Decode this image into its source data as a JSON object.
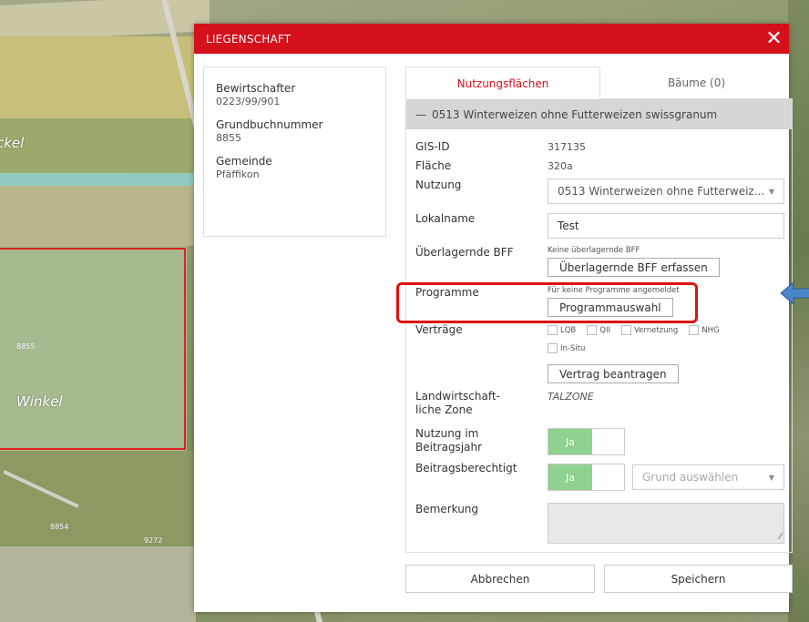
{
  "map": {
    "labels": [
      "ckel",
      "Winkel"
    ],
    "numbers": [
      "8855",
      "8854",
      "9272"
    ]
  },
  "dialog": {
    "title": "LIEGENSCHAFT",
    "close_glyph": "✕",
    "info": {
      "bewirtschafter_label": "Bewirtschafter",
      "bewirtschafter_value": "0223/99/901",
      "grundbuch_label": "Grundbuchnummer",
      "grundbuch_value": "8855",
      "gemeinde_label": "Gemeinde",
      "gemeinde_value": "Pfäffikon"
    },
    "tabs": [
      {
        "label": "Nutzungsflächen",
        "active": true
      },
      {
        "label": "Bäume (0)",
        "active": false
      }
    ],
    "group": {
      "collapse_glyph": "—",
      "title": "0513 Winterweizen ohne Futterweizen swissgranum"
    },
    "fields": {
      "gis_id_label": "GIS-ID",
      "gis_id_value": "317135",
      "flaeche_label": "Fläche",
      "flaeche_value": "320a",
      "nutzung_label": "Nutzung",
      "nutzung_value": "0513 Winterweizen ohne Futterweiz...",
      "lokalname_label": "Lokalname",
      "lokalname_value": "Test",
      "bff_label": "Überlagernde BFF",
      "bff_note": "Keine überlagernde BFF",
      "bff_button": "Überlagernde BFF erfassen",
      "programme_label": "Programme",
      "programme_note": "Für keine Programme angemeldet",
      "programme_button": "Programmauswahl",
      "vertraege_label": "Verträge",
      "vertraege_options": [
        "LQB",
        "QII",
        "Vernetzung",
        "NHG"
      ],
      "vertraege_option_extra": "In-Situ",
      "vertrag_button": "Vertrag beantragen",
      "zone_label_1": "Landwirtschaft-",
      "zone_label_2": "liche Zone",
      "zone_value": "TALZONE",
      "nutzung_jahr_label_1": "Nutzung im",
      "nutzung_jahr_label_2": "Beitragsjahr",
      "nutzung_jahr_toggle": "Ja",
      "berechtigt_label": "Beitragsberechtigt",
      "berechtigt_toggle": "Ja",
      "grund_placeholder": "Grund auswählen",
      "bemerkung_label": "Bemerkung"
    },
    "footer": {
      "cancel": "Abbrechen",
      "save": "Speichern"
    }
  },
  "colors": {
    "header_red": "#d4101b",
    "toggle_green": "#8fd18f",
    "annotation_red": "#e01010",
    "annotation_arrow": "#4a86c8"
  }
}
